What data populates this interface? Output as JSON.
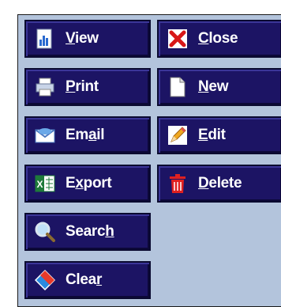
{
  "buttons": {
    "view": {
      "pre": "",
      "ul": "V",
      "post": "iew",
      "icon": "chart-document-icon"
    },
    "close": {
      "pre": "",
      "ul": "C",
      "post": "lose",
      "icon": "red-x-close-icon"
    },
    "print": {
      "pre": "",
      "ul": "P",
      "post": "rint",
      "icon": "printer-icon"
    },
    "new": {
      "pre": "",
      "ul": "N",
      "post": "ew",
      "icon": "blank-page-icon"
    },
    "email": {
      "pre": "Em",
      "ul": "a",
      "post": "il",
      "icon": "envelope-icon"
    },
    "edit": {
      "pre": "",
      "ul": "E",
      "post": "dit",
      "icon": "pencil-icon"
    },
    "export": {
      "pre": "E",
      "ul": "x",
      "post": "port",
      "icon": "excel-icon"
    },
    "delete": {
      "pre": "",
      "ul": "D",
      "post": "elete",
      "icon": "trash-bin-icon"
    },
    "search": {
      "pre": "Searc",
      "ul": "h",
      "post": "",
      "icon": "magnifier-icon"
    },
    "clear": {
      "pre": "Clea",
      "ul": "r",
      "post": "",
      "icon": "eraser-icon"
    }
  },
  "colors": {
    "panel": "#b3c4dc",
    "button": "#1c1464",
    "text": "#ffffff"
  }
}
